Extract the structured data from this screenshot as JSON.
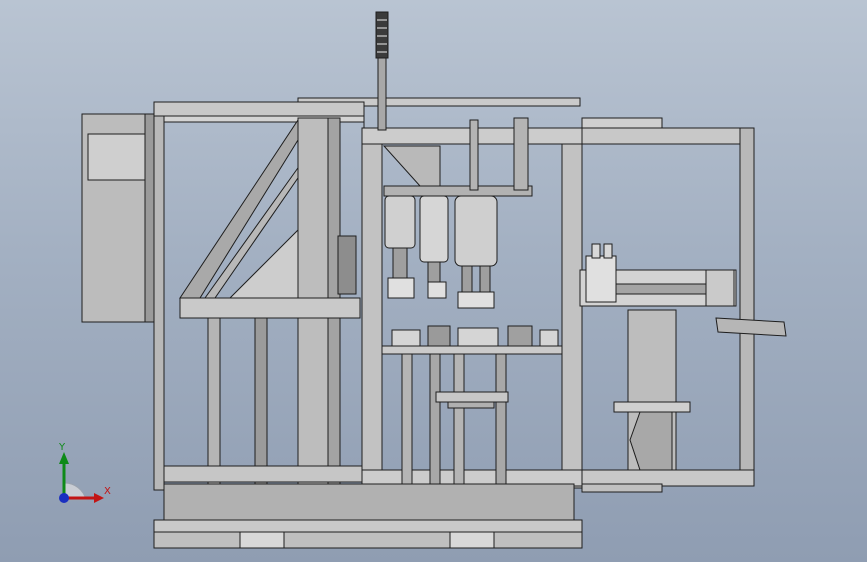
{
  "viewport": {
    "background_top": "#b9c4d2",
    "background_bottom": "#8f9db2",
    "model_fill": "#c4c4c4",
    "model_fill_dark": "#8a8a8a",
    "model_edge": "#1e1e1e"
  },
  "triad": {
    "x_label": "X",
    "y_label": "Y",
    "x_color": "#c21414",
    "y_color": "#0e8a18",
    "z_color": "#1a2fc0"
  }
}
